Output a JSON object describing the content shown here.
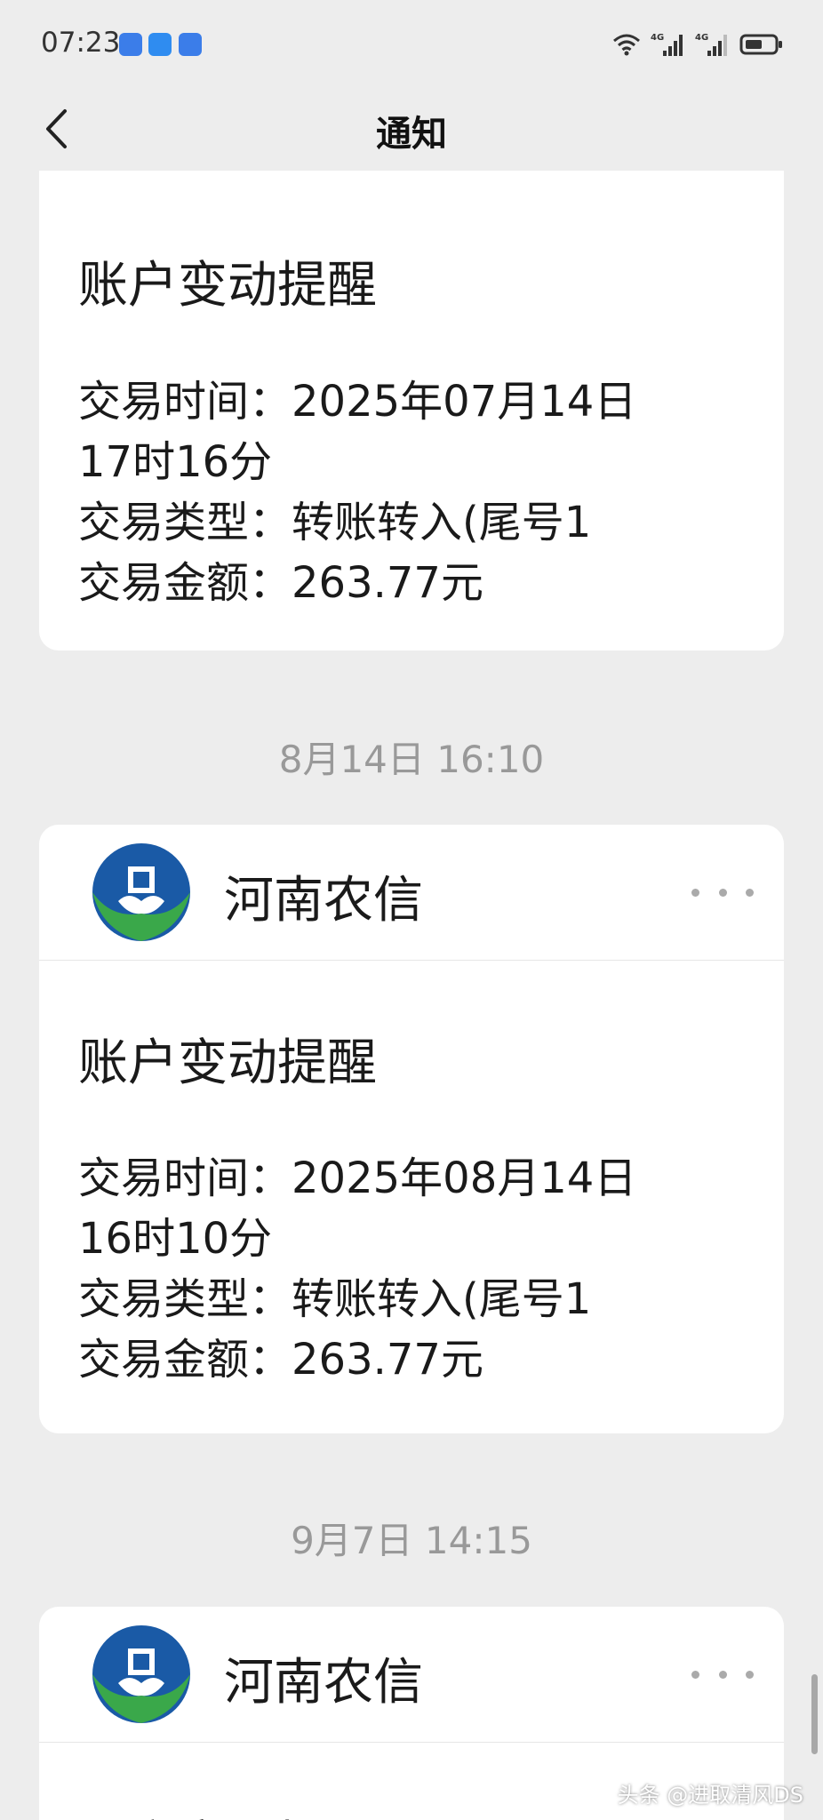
{
  "status_bar": {
    "time": "07:23",
    "network_1": "4G",
    "network_2": "4G"
  },
  "nav": {
    "title": "通知"
  },
  "colors": {
    "logo_blue": "#1a5aa6",
    "logo_green": "#3aa84a",
    "background": "#ededed",
    "timestamp": "#999999"
  },
  "notifications": [
    {
      "title": "账户变动提醒",
      "lines": [
        "交易时间：2025年07月14日",
        "17时16分",
        "交易类型：转账转入(尾号1",
        "交易金额：263.77元"
      ]
    },
    {
      "timestamp": "8月14日 16:10",
      "sender": "河南农信",
      "title": "账户变动提醒",
      "lines": [
        "交易时间：2025年08月14日",
        "16时10分",
        "交易类型：转账转入(尾号1",
        "交易金额：263.77元"
      ]
    },
    {
      "timestamp": "9月7日 14:15",
      "sender": "河南农信",
      "title": "账户变动提醒"
    }
  ],
  "watermark": "头条 @进取清风DS"
}
